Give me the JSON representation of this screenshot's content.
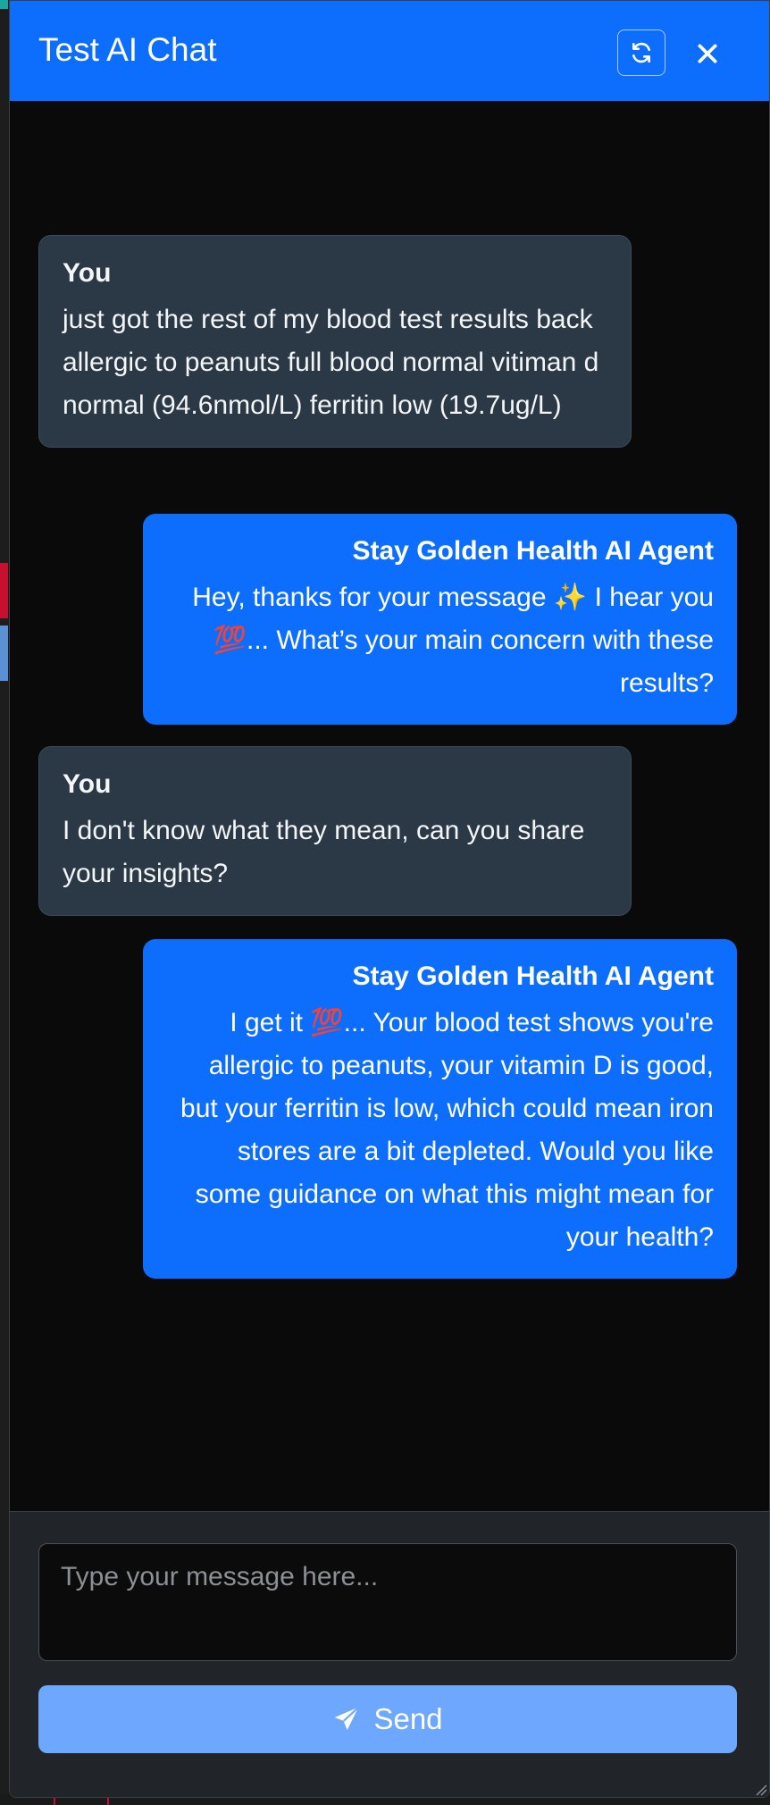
{
  "header": {
    "title": "Test AI Chat",
    "refresh_icon": "refresh-icon",
    "close_icon": "close-icon"
  },
  "messages": [
    {
      "sender": "You",
      "role": "user",
      "text": "just got the rest of my blood test results back allergic to peanuts full blood normal vitiman d normal (94.6nmol/L) ferritin low (19.7ug/L)"
    },
    {
      "sender": "Stay Golden Health AI Agent",
      "role": "agent",
      "text": "Hey, thanks for your message ✨ I hear you 💯... What’s your main concern with these results?"
    },
    {
      "sender": "You",
      "role": "user",
      "text": "I don't know what they mean, can you share your insights?"
    },
    {
      "sender": "Stay Golden Health AI Agent",
      "role": "agent",
      "text": "I get it 💯... Your blood test shows you're allergic to peanuts, your vitamin D is good, but your ferritin is low, which could mean iron stores are a bit depleted. Would you like some guidance on what this might mean for your health?"
    }
  ],
  "composer": {
    "placeholder": "Type your message here...",
    "value": "",
    "send_label": "Send",
    "send_icon": "paper-plane-icon"
  },
  "colors": {
    "header_bg": "#0d6efd",
    "agent_bubble": "#0d6efd",
    "user_bubble": "#2b3846",
    "send_button": "#6ea8fe",
    "panel_bg": "#212529"
  }
}
